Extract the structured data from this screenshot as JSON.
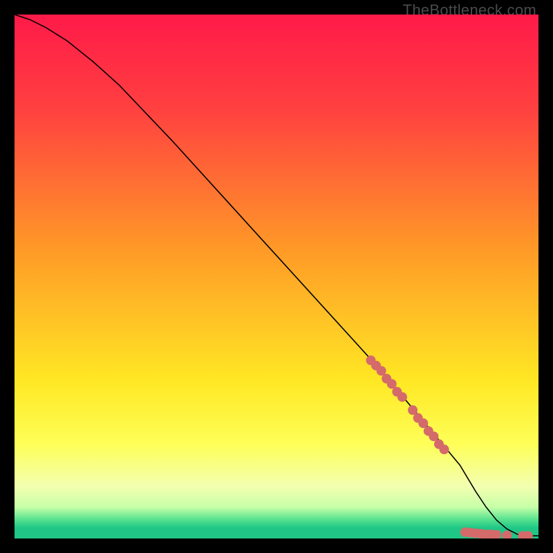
{
  "watermark": "TheBottleneck.com",
  "chart_data": {
    "type": "line",
    "title": "",
    "xlabel": "",
    "ylabel": "",
    "xlim": [
      0,
      100
    ],
    "ylim": [
      0,
      100
    ],
    "grid": false,
    "background_gradient": {
      "stops": [
        {
          "pct": 0,
          "color": "#ff1a49"
        },
        {
          "pct": 18,
          "color": "#ff4040"
        },
        {
          "pct": 45,
          "color": "#ff9a27"
        },
        {
          "pct": 70,
          "color": "#ffe824"
        },
        {
          "pct": 82,
          "color": "#feff58"
        },
        {
          "pct": 90,
          "color": "#f3ffb0"
        },
        {
          "pct": 94,
          "color": "#c7ffa8"
        },
        {
          "pct": 96.5,
          "color": "#52e08f"
        },
        {
          "pct": 98,
          "color": "#1fc686"
        },
        {
          "pct": 100,
          "color": "#1fc686"
        }
      ]
    },
    "series": [
      {
        "name": "bottleneck-curve",
        "color": "#000000",
        "width": 1.6,
        "x": [
          0,
          3,
          6,
          10,
          15,
          20,
          30,
          40,
          50,
          60,
          70,
          80,
          85,
          88,
          90,
          92,
          94,
          96,
          98,
          100
        ],
        "y": [
          100,
          99,
          97.5,
          95,
          91,
          86.5,
          76,
          65,
          54,
          43,
          32,
          20,
          14,
          9,
          6,
          3.5,
          1.8,
          0.8,
          0.5,
          0.5
        ]
      }
    ],
    "points": {
      "name": "data-markers",
      "color": "#d46a6a",
      "radius": 7,
      "x": [
        68,
        69,
        70,
        71,
        72,
        73,
        74,
        76,
        77,
        78,
        79,
        80,
        81,
        82,
        86,
        87,
        88,
        89,
        90,
        91,
        92,
        94,
        97,
        98
      ],
      "y": [
        34,
        33,
        32,
        30.5,
        29.5,
        28,
        27,
        24.5,
        23,
        22,
        20.5,
        19.5,
        18,
        17,
        1.2,
        1.1,
        1.0,
        0.9,
        0.8,
        0.8,
        0.7,
        0.6,
        0.5,
        0.5
      ]
    }
  }
}
